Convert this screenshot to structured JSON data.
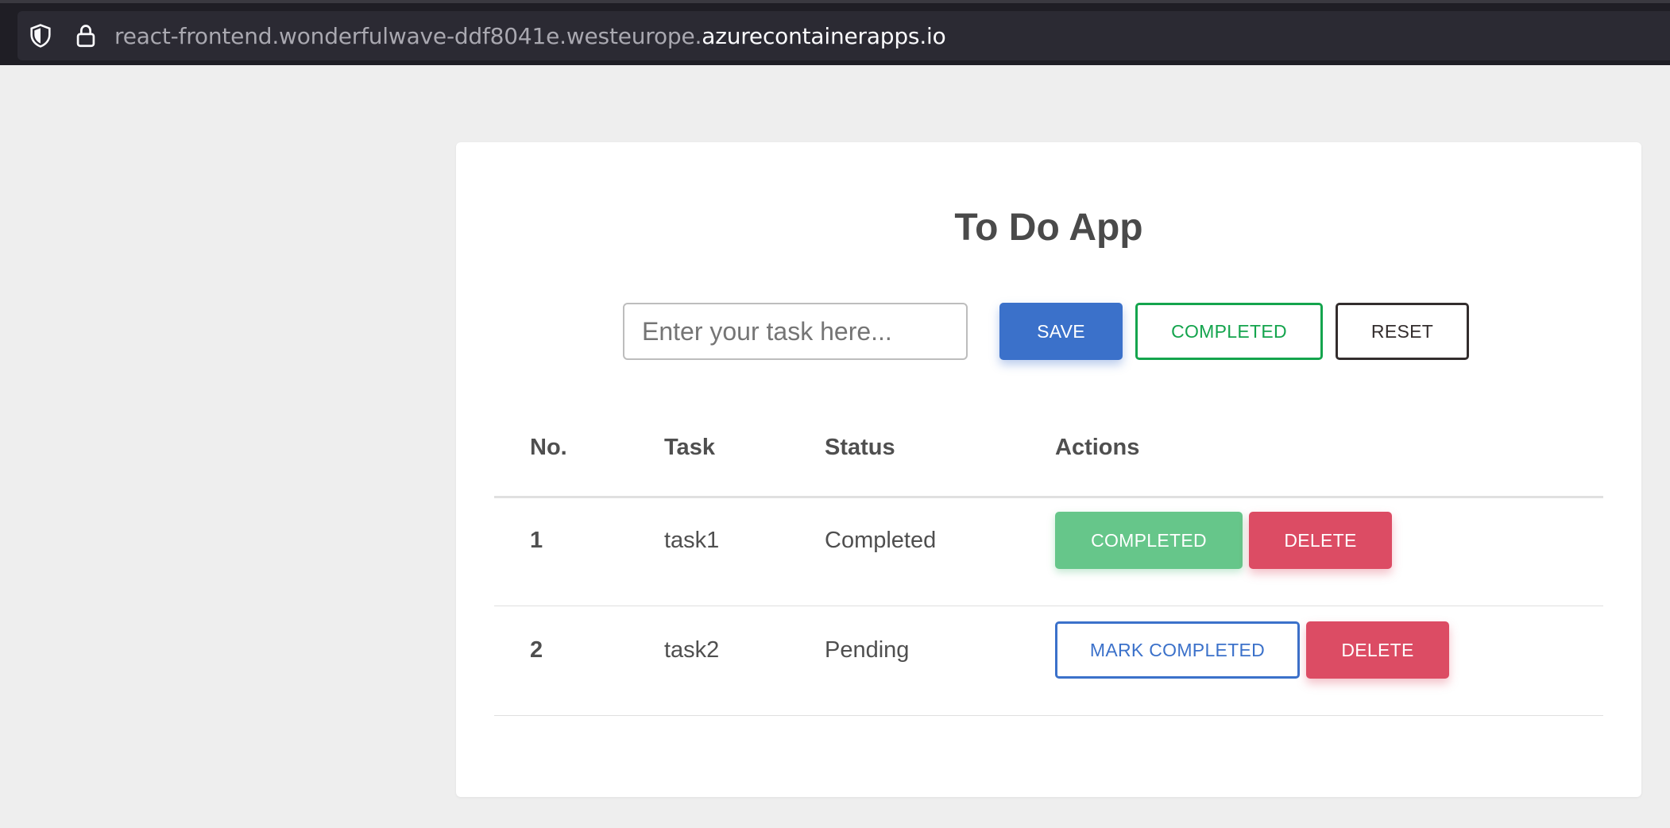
{
  "browser": {
    "url_dim": "react-frontend.wonderfulwave-ddf8041e.westeurope.",
    "url_bright": "azurecontainerapps.io",
    "icons": [
      "shield-icon",
      "lock-icon"
    ]
  },
  "app": {
    "title": "To Do App",
    "input_placeholder": "Enter your task here...",
    "input_value": "",
    "save_label": "SAVE",
    "completed_label": "COMPLETED",
    "reset_label": "RESET"
  },
  "table": {
    "headers": [
      "No.",
      "Task",
      "Status",
      "Actions"
    ],
    "rows": [
      {
        "no": "1",
        "task": "task1",
        "status": "Completed",
        "action_primary": "COMPLETED",
        "action_delete": "DELETE"
      },
      {
        "no": "2",
        "task": "task2",
        "status": "Pending",
        "action_primary": "MARK COMPLETED",
        "action_delete": "DELETE"
      }
    ]
  },
  "colors": {
    "primary": "#3b71ca",
    "success": "#14a44d",
    "success_light": "#66c68a",
    "danger": "#dc4c64",
    "dark": "#332d2d",
    "page_bg": "#eeeeee"
  }
}
